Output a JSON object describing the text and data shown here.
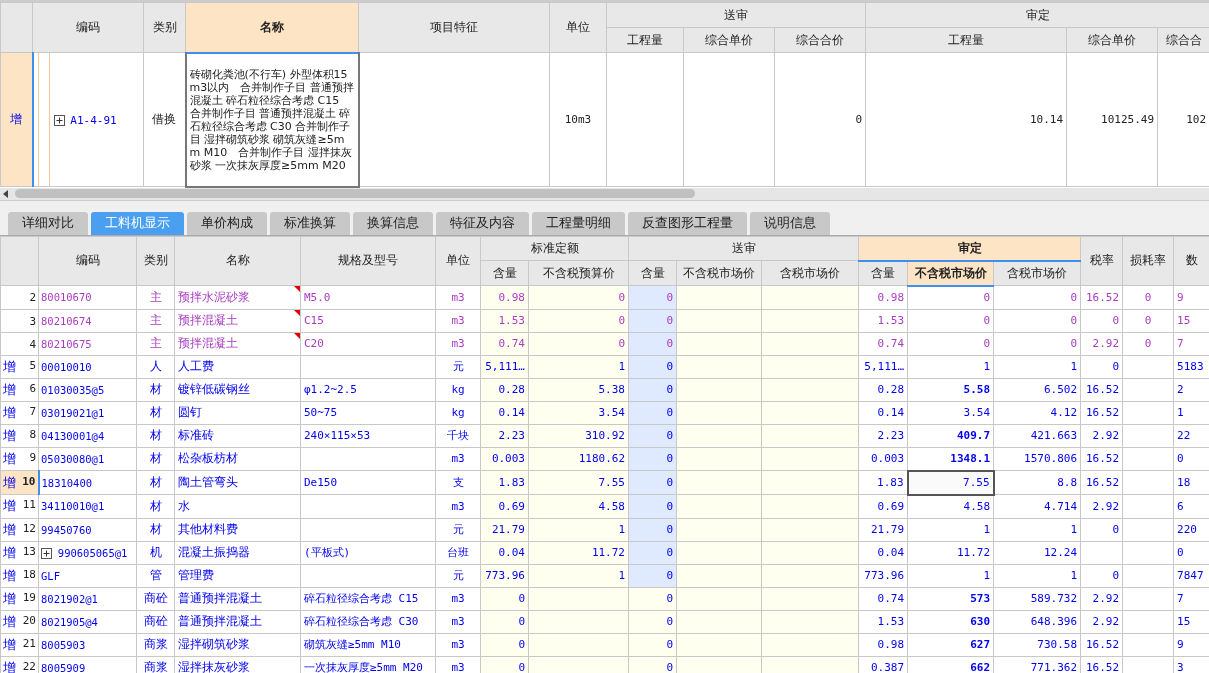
{
  "top_grid": {
    "columns": [
      {
        "label": "编码",
        "selected": false
      },
      {
        "label": "类别",
        "selected": false
      },
      {
        "label": "名称",
        "selected": true
      },
      {
        "label": "项目特征",
        "selected": false
      },
      {
        "label": "单位",
        "selected": false
      }
    ],
    "groups": [
      {
        "label": "送审",
        "columns": [
          "工程量",
          "综合单价",
          "综合合价"
        ]
      },
      {
        "label": "审定",
        "columns": [
          "工程量",
          "综合单价",
          "综合合"
        ]
      }
    ],
    "rows": [
      {
        "marker": "增",
        "selected": true,
        "code": "A1-4-91",
        "expandable": true,
        "category": "借换",
        "name": "砖砌化粪池(不行车) 外型体积15m3以内　合并制作子目 普通预拌混凝土 碎石粒径综合考虑 C15　合并制作子目 普通预拌混凝土 碎石粒径综合考虑 C30 合并制作子目 湿拌砌筑砂浆 砌筑灰缝≥5mm M10　合并制作子目 湿拌抹灰砂浆 一次抹灰厚度≥5mm M20",
        "unit": "10m3",
        "submitted_total": "0",
        "audited_qty": "10.14",
        "audited_price": "10125.49",
        "audited_total": "102"
      }
    ]
  },
  "tabs": [
    {
      "label": "详细对比",
      "selected": false
    },
    {
      "label": "工料机显示",
      "selected": true
    },
    {
      "label": "单价构成",
      "selected": false
    },
    {
      "label": "标准换算",
      "selected": false
    },
    {
      "label": "换算信息",
      "selected": false
    },
    {
      "label": "特征及内容",
      "selected": false
    },
    {
      "label": "工程量明细",
      "selected": false
    },
    {
      "label": "反查图形工程量",
      "selected": false
    },
    {
      "label": "说明信息",
      "selected": false
    }
  ],
  "detail_grid": {
    "columns": [
      "编码",
      "类别",
      "名称",
      "规格及型号",
      "单位"
    ],
    "groups": [
      {
        "label": "标准定额",
        "selected": false,
        "columns": [
          {
            "label": "含量",
            "selected": false
          },
          {
            "label": "不含税预算价",
            "selected": false
          }
        ]
      },
      {
        "label": "送审",
        "selected": false,
        "columns": [
          {
            "label": "含量",
            "selected": false
          },
          {
            "label": "不含税市场价",
            "selected": false
          },
          {
            "label": "含税市场价",
            "selected": false
          }
        ]
      },
      {
        "label": "审定",
        "selected": true,
        "columns": [
          {
            "label": "含量",
            "selected": false
          },
          {
            "label": "不含税市场价",
            "selected": true
          },
          {
            "label": "含税市场价",
            "selected": false
          }
        ]
      }
    ],
    "trailing_columns": [
      "税率",
      "损耗率",
      "数"
    ],
    "rows": [
      {
        "num": "2",
        "kind": "main",
        "selected": false,
        "focused": false,
        "flagged": true,
        "code": "80010670",
        "expandable": false,
        "category": "主",
        "name": "预拌水泥砂浆",
        "spec": "M5.0",
        "unit": "m3",
        "submitted_shaded": true,
        "price_changed": false,
        "std_qty": "0.98",
        "std_price": "0",
        "sub_qty": "0",
        "aud_qty": "0.98",
        "aud_price": "0",
        "aud_tax_price": "0",
        "tax": "16.52",
        "loss": "0",
        "amount": "9"
      },
      {
        "num": "3",
        "kind": "main",
        "selected": false,
        "focused": false,
        "flagged": true,
        "code": "80210674",
        "expandable": false,
        "category": "主",
        "name": "预拌混凝土",
        "spec": "C15",
        "unit": "m3",
        "submitted_shaded": true,
        "price_changed": false,
        "std_qty": "1.53",
        "std_price": "0",
        "sub_qty": "0",
        "aud_qty": "1.53",
        "aud_price": "0",
        "aud_tax_price": "0",
        "tax": "0",
        "loss": "0",
        "amount": "15"
      },
      {
        "num": "4",
        "kind": "main",
        "selected": false,
        "focused": false,
        "flagged": true,
        "code": "80210675",
        "expandable": false,
        "category": "主",
        "name": "预拌混凝土",
        "spec": "C20",
        "unit": "m3",
        "submitted_shaded": true,
        "price_changed": false,
        "std_qty": "0.74",
        "std_price": "0",
        "sub_qty": "0",
        "aud_qty": "0.74",
        "aud_price": "0",
        "aud_tax_price": "0",
        "tax": "2.92",
        "loss": "0",
        "amount": "7"
      },
      {
        "marker": "增",
        "num": "5",
        "kind": "added",
        "selected": false,
        "focused": false,
        "flagged": false,
        "code": "00010010",
        "expandable": false,
        "category": "人",
        "name": "人工费",
        "unit": "元",
        "submitted_shaded": true,
        "price_changed": false,
        "std_qty": "5,111…",
        "std_price": "1",
        "sub_qty": "0",
        "aud_qty": "5,111…",
        "aud_price": "1",
        "aud_tax_price": "1",
        "tax": "0",
        "amount": "5183"
      },
      {
        "marker": "增",
        "num": "6",
        "kind": "added",
        "selected": false,
        "focused": false,
        "flagged": false,
        "code": "01030035@5",
        "expandable": false,
        "category": "材",
        "name": "镀锌低碳钢丝",
        "spec": "φ1.2~2.5",
        "unit": "kg",
        "submitted_shaded": true,
        "price_changed": true,
        "std_qty": "0.28",
        "std_price": "5.38",
        "sub_qty": "0",
        "aud_qty": "0.28",
        "aud_price": "5.58",
        "aud_tax_price": "6.502",
        "tax": "16.52",
        "amount": "2"
      },
      {
        "marker": "增",
        "num": "7",
        "kind": "added",
        "selected": false,
        "focused": false,
        "flagged": false,
        "code": "03019021@1",
        "expandable": false,
        "category": "材",
        "name": "圆钉",
        "spec": "50~75",
        "unit": "kg",
        "submitted_shaded": true,
        "price_changed": false,
        "std_qty": "0.14",
        "std_price": "3.54",
        "sub_qty": "0",
        "aud_qty": "0.14",
        "aud_price": "3.54",
        "aud_tax_price": "4.12",
        "tax": "16.52",
        "amount": "1"
      },
      {
        "marker": "增",
        "num": "8",
        "kind": "added",
        "selected": false,
        "focused": false,
        "flagged": false,
        "code": "04130001@4",
        "expandable": false,
        "category": "材",
        "name": "标准砖",
        "spec": "240×115×53",
        "unit": "千块",
        "submitted_shaded": true,
        "price_changed": true,
        "std_qty": "2.23",
        "std_price": "310.92",
        "sub_qty": "0",
        "aud_qty": "2.23",
        "aud_price": "409.7",
        "aud_tax_price": "421.663",
        "tax": "2.92",
        "amount": "22"
      },
      {
        "marker": "增",
        "num": "9",
        "kind": "added",
        "selected": false,
        "focused": false,
        "flagged": false,
        "code": "05030080@1",
        "expandable": false,
        "category": "材",
        "name": "松杂板枋材",
        "unit": "m3",
        "submitted_shaded": true,
        "price_changed": true,
        "std_qty": "0.003",
        "std_price": "1180.62",
        "sub_qty": "0",
        "aud_qty": "0.003",
        "aud_price": "1348.1",
        "aud_tax_price": "1570.806",
        "tax": "16.52",
        "amount": "0"
      },
      {
        "marker": "增",
        "num": "10",
        "kind": "added",
        "selected": true,
        "focused": true,
        "flagged": false,
        "code": "18310400",
        "expandable": false,
        "category": "材",
        "name": "陶土管弯头",
        "spec": "De150",
        "unit": "支",
        "submitted_shaded": true,
        "price_changed": false,
        "std_qty": "1.83",
        "std_price": "7.55",
        "sub_qty": "0",
        "aud_qty": "1.83",
        "aud_price": "7.55",
        "aud_tax_price": "8.8",
        "tax": "16.52",
        "amount": "18"
      },
      {
        "marker": "增",
        "num": "11",
        "kind": "added",
        "selected": false,
        "focused": false,
        "flagged": false,
        "code": "34110010@1",
        "expandable": false,
        "category": "材",
        "name": "水",
        "unit": "m3",
        "submitted_shaded": true,
        "price_changed": false,
        "std_qty": "0.69",
        "std_price": "4.58",
        "sub_qty": "0",
        "aud_qty": "0.69",
        "aud_price": "4.58",
        "aud_tax_price": "4.714",
        "tax": "2.92",
        "amount": "6"
      },
      {
        "marker": "增",
        "num": "12",
        "kind": "added",
        "selected": false,
        "focused": false,
        "flagged": false,
        "code": "99450760",
        "expandable": false,
        "category": "材",
        "name": "其他材料费",
        "unit": "元",
        "submitted_shaded": true,
        "price_changed": false,
        "std_qty": "21.79",
        "std_price": "1",
        "sub_qty": "0",
        "aud_qty": "21.79",
        "aud_price": "1",
        "aud_tax_price": "1",
        "tax": "0",
        "amount": "220"
      },
      {
        "marker": "增",
        "num": "13",
        "kind": "added",
        "selected": false,
        "focused": false,
        "flagged": false,
        "code": "990605065@1",
        "expandable": true,
        "category": "机",
        "name": "混凝土振捣器",
        "spec": "(平板式)",
        "unit": "台班",
        "submitted_shaded": true,
        "price_changed": false,
        "std_qty": "0.04",
        "std_price": "11.72",
        "sub_qty": "0",
        "aud_qty": "0.04",
        "aud_price": "11.72",
        "aud_tax_price": "12.24",
        "amount": "0"
      },
      {
        "marker": "增",
        "num": "18",
        "kind": "added",
        "selected": false,
        "focused": false,
        "flagged": false,
        "code": "GLF",
        "expandable": false,
        "category": "管",
        "name": "管理费",
        "unit": "元",
        "submitted_shaded": true,
        "price_changed": false,
        "std_qty": "773.96",
        "std_price": "1",
        "sub_qty": "0",
        "aud_qty": "773.96",
        "aud_price": "1",
        "aud_tax_price": "1",
        "tax": "0",
        "amount": "7847"
      },
      {
        "marker": "增",
        "num": "19",
        "kind": "added",
        "selected": false,
        "focused": false,
        "flagged": false,
        "code": "8021902@1",
        "expandable": false,
        "category": "商砼",
        "name": "普通预拌混凝土",
        "spec": "碎石粒径综合考虑 C15",
        "unit": "m3",
        "submitted_shaded": false,
        "price_changed": true,
        "std_qty": "0",
        "sub_qty": "0",
        "aud_qty": "0.74",
        "aud_price": "573",
        "aud_tax_price": "589.732",
        "tax": "2.92",
        "amount": "7"
      },
      {
        "marker": "增",
        "num": "20",
        "kind": "added",
        "selected": false,
        "focused": false,
        "flagged": false,
        "code": "8021905@4",
        "expandable": false,
        "category": "商砼",
        "name": "普通预拌混凝土",
        "spec": "碎石粒径综合考虑 C30",
        "unit": "m3",
        "submitted_shaded": false,
        "price_changed": true,
        "std_qty": "0",
        "sub_qty": "0",
        "aud_qty": "1.53",
        "aud_price": "630",
        "aud_tax_price": "648.396",
        "tax": "2.92",
        "amount": "15"
      },
      {
        "marker": "增",
        "num": "21",
        "kind": "added",
        "selected": false,
        "focused": false,
        "flagged": false,
        "code": "8005903",
        "expandable": false,
        "category": "商浆",
        "name": "湿拌砌筑砂浆",
        "spec": "砌筑灰缝≥5mm M10",
        "unit": "m3",
        "submitted_shaded": false,
        "price_changed": true,
        "std_qty": "0",
        "sub_qty": "0",
        "aud_qty": "0.98",
        "aud_price": "627",
        "aud_tax_price": "730.58",
        "tax": "16.52",
        "amount": "9"
      },
      {
        "marker": "增",
        "num": "22",
        "kind": "added",
        "selected": false,
        "focused": false,
        "flagged": false,
        "code": "8005909",
        "expandable": false,
        "category": "商浆",
        "name": "湿拌抹灰砂浆",
        "spec": "一次抹灰厚度≥5mm M20",
        "unit": "m3",
        "submitted_shaded": false,
        "price_changed": true,
        "std_qty": "0",
        "sub_qty": "0",
        "aud_qty": "0.387",
        "aud_price": "662",
        "aud_tax_price": "771.362",
        "tax": "16.52",
        "amount": "3"
      }
    ]
  }
}
